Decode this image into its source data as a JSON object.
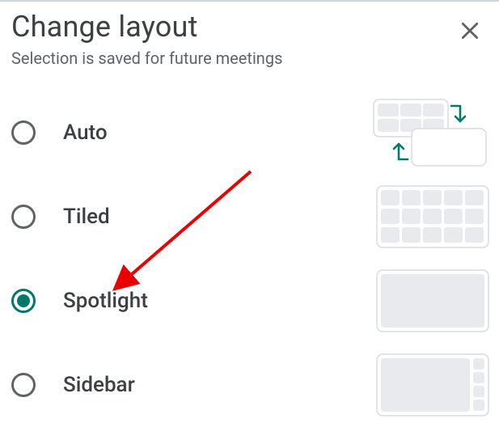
{
  "dialog": {
    "title": "Change layout",
    "subtitle": "Selection is saved for future meetings"
  },
  "options": [
    {
      "key": "auto",
      "label": "Auto",
      "selected": false
    },
    {
      "key": "tiled",
      "label": "Tiled",
      "selected": false
    },
    {
      "key": "spotlight",
      "label": "Spotlight",
      "selected": true
    },
    {
      "key": "sidebar",
      "label": "Sidebar",
      "selected": false
    }
  ],
  "colors": {
    "accent": "#00796b",
    "tile": "#e8eaed",
    "border": "#dadce0",
    "text": "#3c4043",
    "muted": "#5f6368",
    "arrow": "#ea0000"
  }
}
